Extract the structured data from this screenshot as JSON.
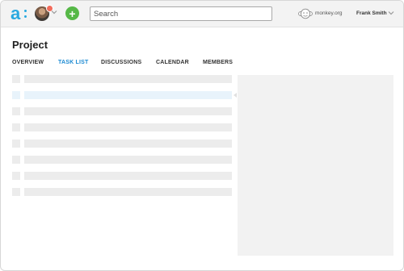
{
  "header": {
    "search": {
      "placeholder": "Search",
      "value": ""
    },
    "org": {
      "name": "monkey.org"
    },
    "user": {
      "name": "Frank Smith"
    },
    "icons": {
      "logo": "app-logo",
      "avatar": "user-avatar",
      "notification": "notification-badge",
      "add": "plus-icon",
      "org": "monkey-icon",
      "menu": "chevron-down-icon"
    },
    "colors": {
      "logo": "#29a9e0",
      "add_button": "#56b847",
      "notification_badge": "#f26b5b"
    }
  },
  "page": {
    "title": "Project",
    "tabs": [
      {
        "label": "OVERVIEW",
        "active": false
      },
      {
        "label": "TASK LIST",
        "active": true
      },
      {
        "label": "DISCUSSIONS",
        "active": false
      },
      {
        "label": "CALENDAR",
        "active": false
      },
      {
        "label": "MEMBERS",
        "active": false
      }
    ],
    "active_tab_color": "#1b8ad2"
  },
  "task_list": {
    "row_count": 8,
    "selected_row": 1
  }
}
